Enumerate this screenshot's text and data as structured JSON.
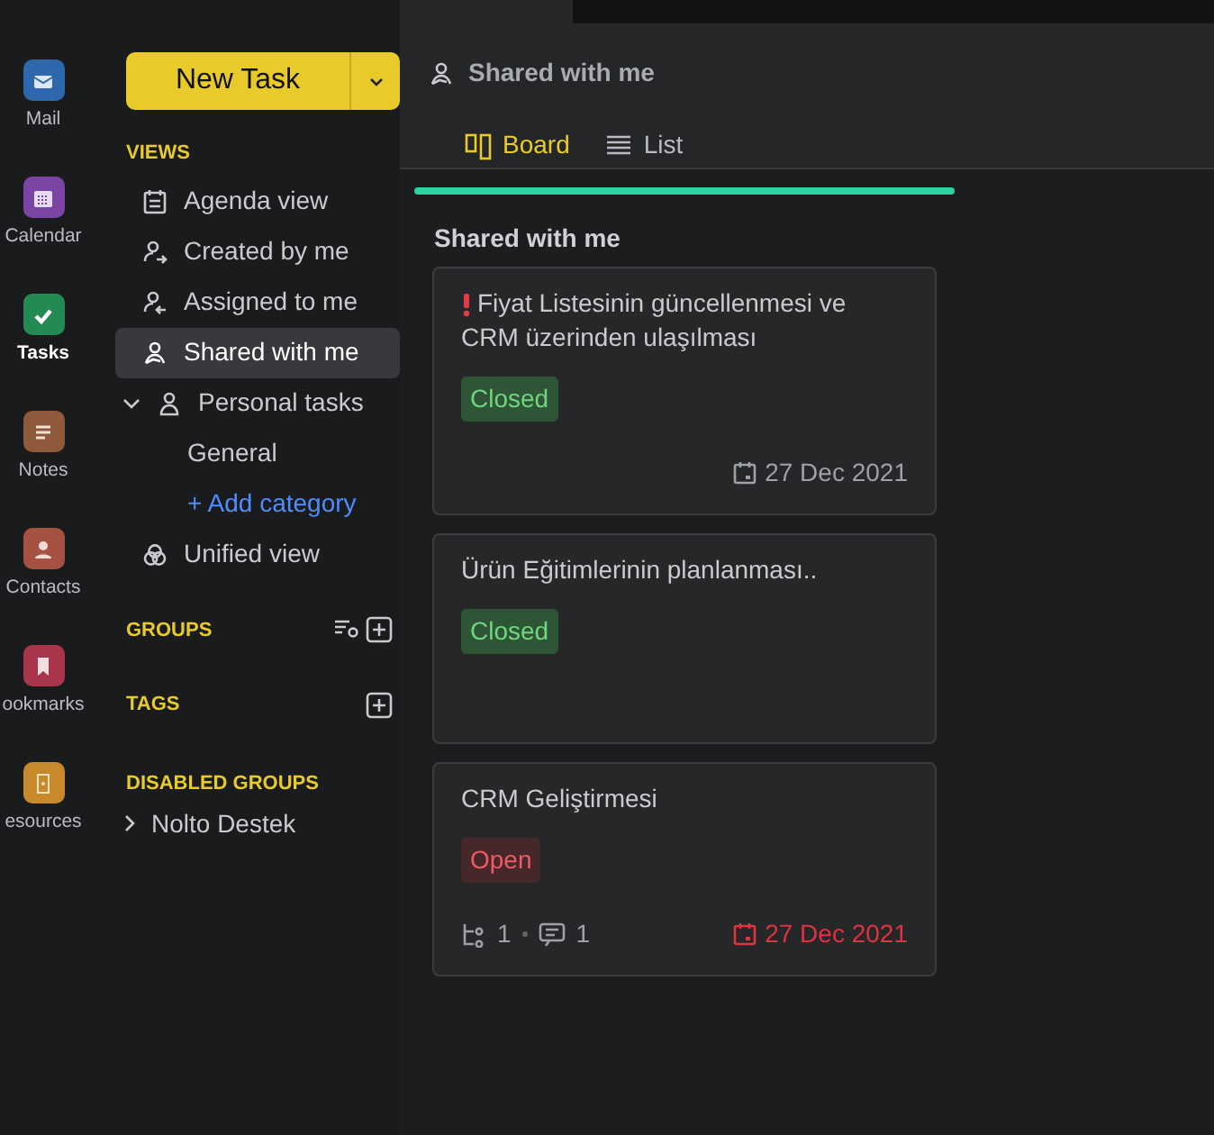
{
  "rail": [
    {
      "label": "Mail",
      "color": "#2d68ad",
      "selected": false
    },
    {
      "label": "Calendar",
      "color": "#7b45a6",
      "selected": false
    },
    {
      "label": "Tasks",
      "color": "#238a52",
      "selected": true
    },
    {
      "label": "Notes",
      "color": "#8f5a3c",
      "selected": false
    },
    {
      "label": "Contacts",
      "color": "#a65242",
      "selected": false
    },
    {
      "label": "ookmarks",
      "color": "#a8354a",
      "selected": false
    },
    {
      "label": "esources",
      "color": "#c8892a",
      "selected": false
    }
  ],
  "new_task_button": "New Task",
  "views": {
    "heading": "VIEWS",
    "items": [
      {
        "label": "Agenda view",
        "selected": false
      },
      {
        "label": "Created by me",
        "selected": false
      },
      {
        "label": "Assigned to me",
        "selected": false
      },
      {
        "label": "Shared with me",
        "selected": true
      },
      {
        "label": "Personal tasks",
        "selected": false,
        "expanded": true,
        "children": [
          {
            "label": "General"
          }
        ],
        "add_label": "+ Add category"
      },
      {
        "label": "Unified view",
        "selected": false
      }
    ]
  },
  "groups": {
    "heading": "GROUPS"
  },
  "tags": {
    "heading": "TAGS"
  },
  "disabled_groups": {
    "heading": "DISABLED GROUPS",
    "items": [
      {
        "label": "Nolto Destek",
        "expanded": false
      }
    ]
  },
  "header": {
    "title": "Shared with me",
    "tabs": [
      {
        "label": "Board",
        "selected": true
      },
      {
        "label": "List",
        "selected": false
      }
    ]
  },
  "column": {
    "title": "Shared with me",
    "cards": [
      {
        "title": "Fiyat Listesinin güncellenmesi ve CRM üzerinden ulaşılması",
        "important": true,
        "status": "Closed",
        "kind": "closed",
        "due": "27 Dec 2021",
        "overdue": false
      },
      {
        "title": "Ürün Eğitimlerinin planlanması..",
        "important": false,
        "status": "Closed",
        "kind": "closed"
      },
      {
        "title": "CRM Geliştirmesi",
        "important": false,
        "status": "Open",
        "kind": "open",
        "subtasks": "1",
        "comments": "1",
        "due": "27 Dec 2021",
        "overdue": true
      }
    ]
  }
}
